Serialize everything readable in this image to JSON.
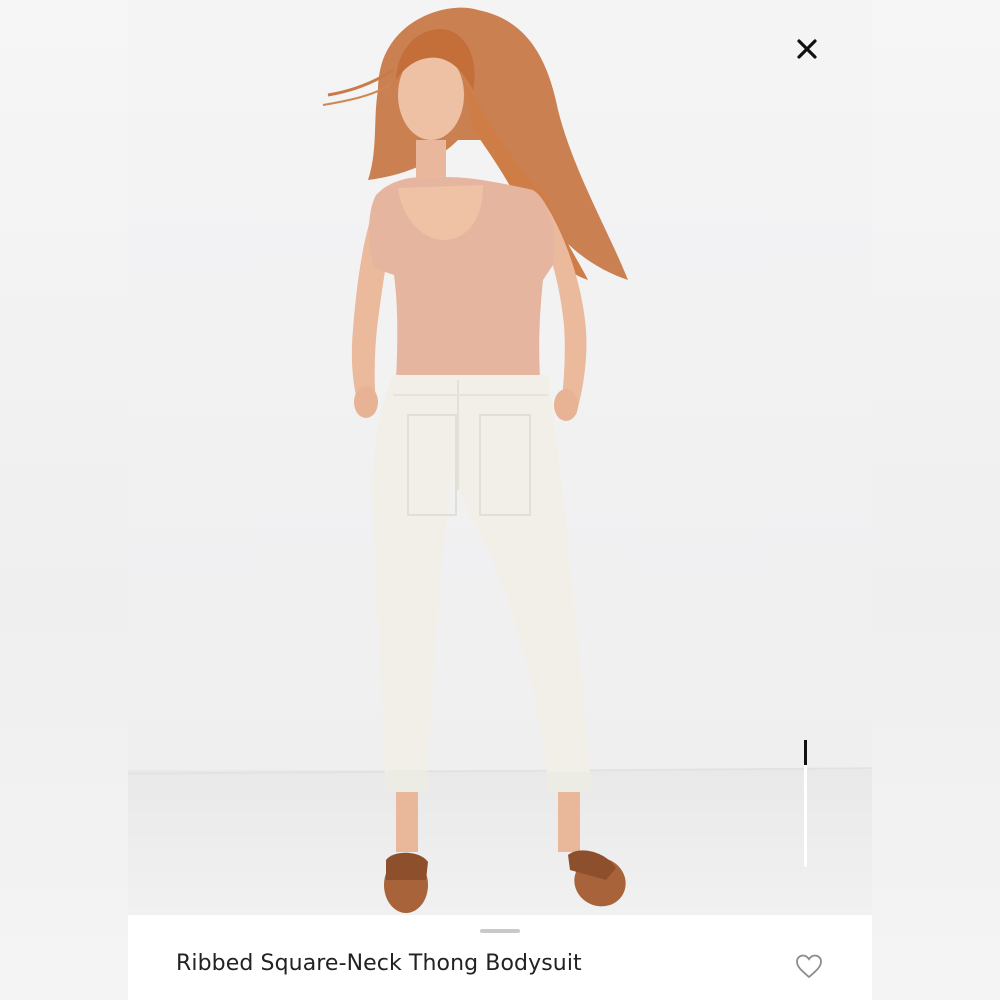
{
  "product": {
    "title": "Ribbed Square-Neck Thong Bodysuit"
  },
  "controls": {
    "close_icon": "close-icon",
    "favorite_icon": "heart-outline-icon"
  },
  "gallery": {
    "current_image": 1,
    "progress": 0.2
  }
}
